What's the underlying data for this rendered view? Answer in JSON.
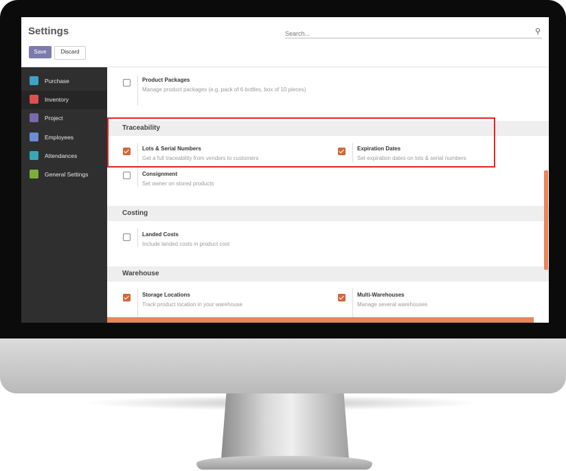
{
  "window": {
    "title": "Settings"
  },
  "search": {
    "placeholder": "Search...",
    "icon": "search-icon"
  },
  "toolbar": {
    "save_label": "Save",
    "discard_label": "Discard"
  },
  "colors": {
    "accent": "#7c7bad",
    "checkbox": "#d6693c",
    "highlight": "#e32222",
    "sidebar": "#2f2f2f"
  },
  "sidebar": {
    "items": [
      {
        "label": "Purchase",
        "icon": "purchase-icon",
        "color": "#3fa3c7"
      },
      {
        "label": "Inventory",
        "icon": "inventory-icon",
        "color": "#e0504f"
      },
      {
        "label": "Project",
        "icon": "project-icon",
        "color": "#7b69ad"
      },
      {
        "label": "Employees",
        "icon": "employees-icon",
        "color": "#6c8cd3"
      },
      {
        "label": "Attendances",
        "icon": "attendances-icon",
        "color": "#37a7b4"
      },
      {
        "label": "General Settings",
        "icon": "gear-icon",
        "color": "#7dae3c"
      }
    ],
    "active": "Inventory"
  },
  "content": {
    "product_packages": {
      "title": "Product Packages",
      "desc": "Manage product packages (e.g. pack of 6 bottles, box of 10 pieces)",
      "checked": false
    },
    "traceability": {
      "heading": "Traceability",
      "lots": {
        "title": "Lots & Serial Numbers",
        "desc": "Get a full traceability from vendors to customers",
        "checked": true
      },
      "expiration": {
        "title": "Expiration Dates",
        "desc": "Set expiration dates on lots & serial numbers",
        "checked": true
      },
      "consignment": {
        "title": "Consignment",
        "desc": "Set owner on stored products",
        "checked": false
      }
    },
    "costing": {
      "heading": "Costing",
      "landed": {
        "title": "Landed Costs",
        "desc": "Include landed costs in product cost",
        "checked": false
      }
    },
    "warehouse": {
      "heading": "Warehouse",
      "storage": {
        "title": "Storage Locations",
        "desc": "Track product location in your warehouse",
        "checked": true
      },
      "multi": {
        "title": "Multi-Warehouses",
        "desc": "Manage several warehouses",
        "checked": true
      }
    }
  }
}
